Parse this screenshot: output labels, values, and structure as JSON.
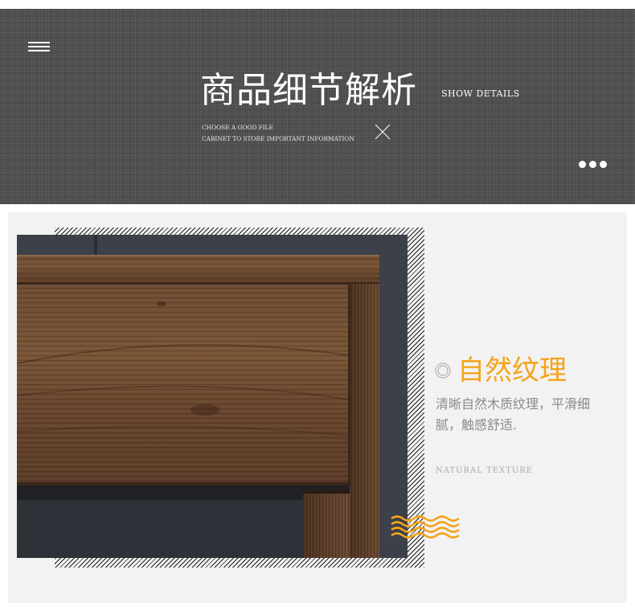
{
  "banner": {
    "title": "商品细节解析",
    "subtitle": "SHOW DETAILS",
    "caption_line1": "CHOOSE A GOOD FILE",
    "caption_line2": "CABINET TO STORE IMPORTANT INFORMATION",
    "menu_icon": "hamburger-menu-icon",
    "close_icon": "cross-icon",
    "more_icon": "more-dots-icon"
  },
  "feature": {
    "title": "自然纹理",
    "description": "清晰自然木质纹理，平滑细腻，触感舒适.",
    "english_label": "NATURAL TEXTURE",
    "bullet_icon": "concentric-circle-icon",
    "decor_icon": "wave-icon"
  },
  "colors": {
    "banner_bg": "#4b4b4b",
    "accent": "#f5a31a",
    "panel_bg": "#f2f2f2",
    "wood": "#6b4a33",
    "backdrop": "#3c4049"
  }
}
